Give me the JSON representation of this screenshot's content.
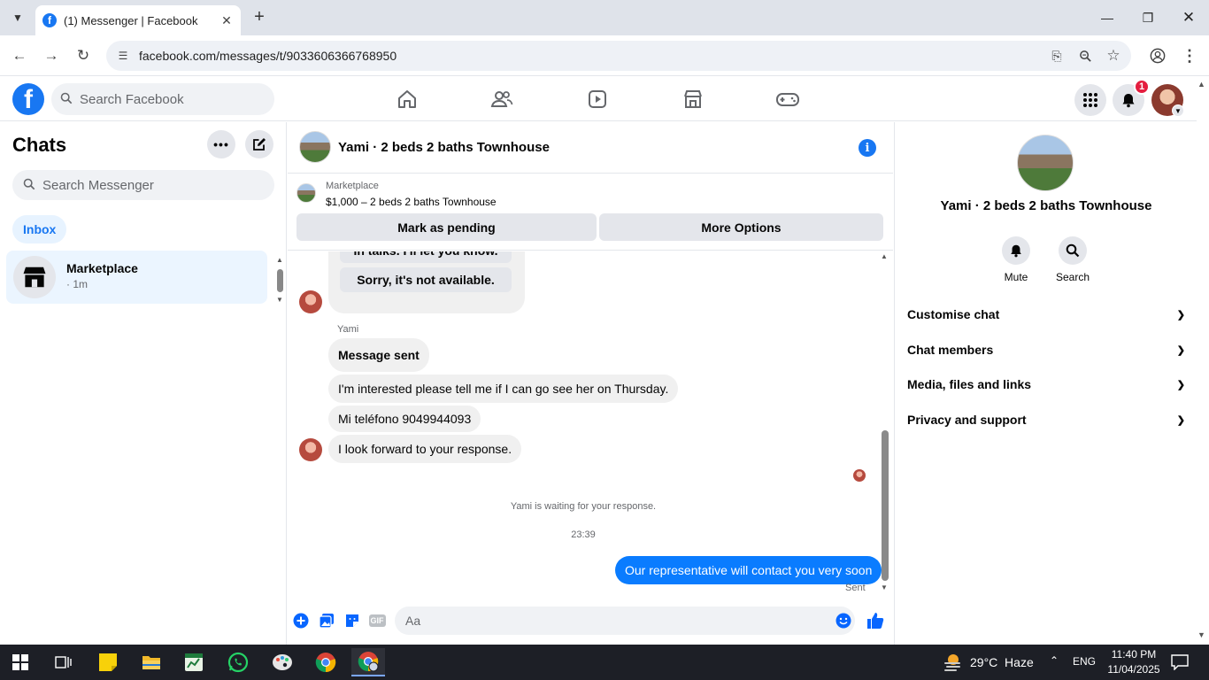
{
  "browser": {
    "tab_title": "(1) Messenger | Facebook",
    "url": "facebook.com/messages/t/9033606366768950",
    "tab_close": "✕",
    "new_tab": "+"
  },
  "fb_header": {
    "logo_letter": "f",
    "search_placeholder": "Search Facebook",
    "notification_count": "1"
  },
  "chats": {
    "title": "Chats",
    "search_placeholder": "Search Messenger",
    "filter_label": "Inbox",
    "items": [
      {
        "name": "Marketplace",
        "time": "· 1m"
      }
    ]
  },
  "conversation": {
    "title": "Yami · 2 beds 2 baths Townhouse",
    "marketplace_label": "Marketplace",
    "listing": "$1,000 – 2 beds 2 baths Townhouse",
    "mark_pending_label": "Mark as pending",
    "more_options_label": "More Options",
    "quick_replies": [
      "In talks. I'll let you know.",
      "Sorry, it's not available."
    ],
    "sender_name": "Yami",
    "messages_in": [
      "Message sent",
      "I'm interested please tell me if I can go see her on Thursday.",
      "Mi teléfono 9049944093",
      "I look forward to your response."
    ],
    "waiting_text": "Yami is waiting for your response.",
    "timestamp": "23:39",
    "message_out": "Our representative will contact you very soon",
    "sent_label": "Sent",
    "composer_placeholder": "Aa",
    "gif_label": "GIF"
  },
  "info_panel": {
    "title": "Yami · 2 beds 2 baths Townhouse",
    "mute_label": "Mute",
    "search_label": "Search",
    "sections": [
      "Customise chat",
      "Chat members",
      "Media, files and links",
      "Privacy and support"
    ]
  },
  "taskbar": {
    "weather": "29°C  Haze",
    "language": "ENG",
    "time": "11:40 PM",
    "date": "11/04/2025"
  },
  "colors": {
    "brand": "#1877f2",
    "outgoing_bubble": "#0a7cff",
    "incoming_bubble": "#f0f0f0",
    "badge": "#e41e3f",
    "taskbar": "#1d1f26"
  }
}
